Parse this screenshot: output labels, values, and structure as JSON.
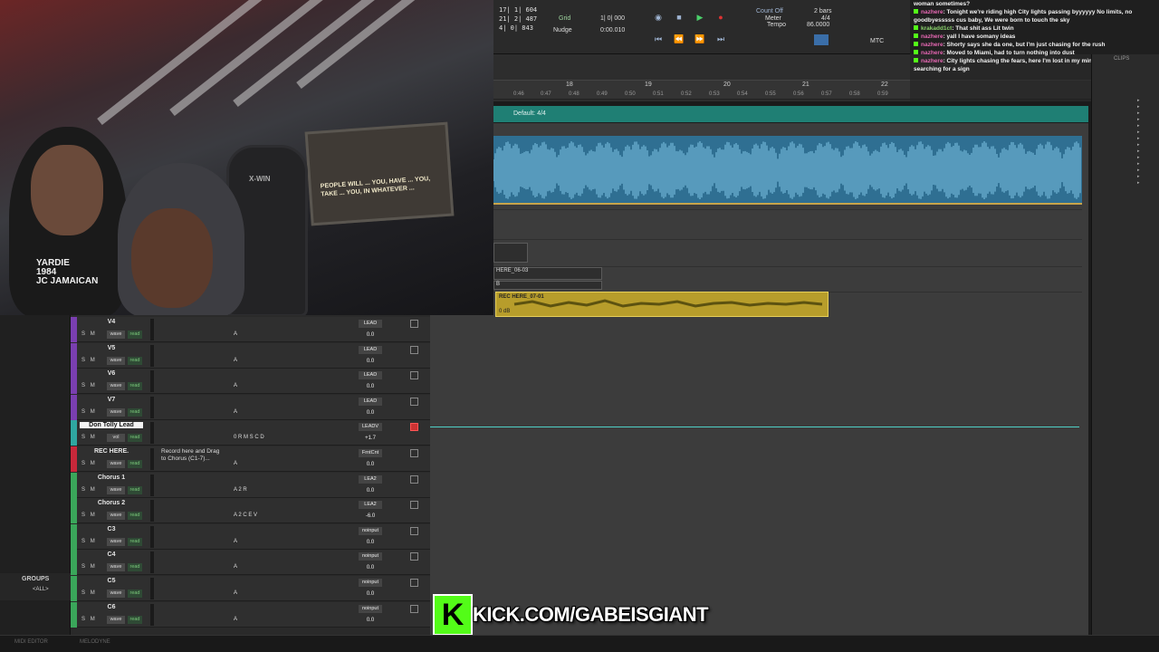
{
  "overlay": {
    "shirt_text_line1": "YARDIE",
    "shirt_text_line2": "1984",
    "shirt_text_line3": "JC JAMAICAN",
    "monitor_text": "PEOPLE WILL ... YOU, HAVE ... YOU, TAKE ... YOU, IN WHATEVER ...",
    "chair_brand": "X-WIN",
    "banner_url": "KICK.COM/GABEISGIANT",
    "banner_logo": "K",
    "banner_color": "#53fc18"
  },
  "transport": {
    "counter_main": "17| 1| 604",
    "counter_2": "21| 2| 487",
    "counter_3": "4| 0| 843",
    "grid_label": "Grid",
    "grid_value": "1| 0| 000",
    "nudge_label": "Nudge",
    "nudge_value": "0:00.010",
    "count_off": "Count Off",
    "meter_label": "Meter",
    "meter_value": "4/4",
    "tempo_label": "Tempo",
    "tempo_value": "86.0000",
    "bars_value": "2 bars",
    "mtc_label": "MTC"
  },
  "ruler": {
    "bars": [
      "18",
      "19",
      "20",
      "21",
      "22"
    ],
    "minutes": [
      "0:46",
      "0:47",
      "0:48",
      "0:49",
      "0:50",
      "0:51",
      "0:52",
      "0:53",
      "0:54",
      "0:55",
      "0:56",
      "0:57",
      "0:58",
      "0:59"
    ],
    "meter_lane_label": "Default: 4/4"
  },
  "clips": {
    "clip_a": "HERE_06-03",
    "clip_b": "B",
    "clip_yellow": "REC HERE_07-01",
    "clip_yellow_db": "0 dB",
    "clip_list_title": "CLIPS"
  },
  "chat": [
    {
      "user": "",
      "text": "woman sometimes?"
    },
    {
      "user": "nazhere",
      "text": ": Tonight we're riding high City lights passing byyyyyy No limits, no goodbyesssss cus baby, We were born to touch the sky"
    },
    {
      "user": "krakadd1ct",
      "text": ": That shit ass Lit twin"
    },
    {
      "user": "nazhere",
      "text": ": yall I have somany ideas"
    },
    {
      "user": "nazhere",
      "text": ": Shorty says she da one, but I'm just chasing for the rush"
    },
    {
      "user": "nazhere",
      "text": ": Moved to Miami, had to turn nothing into dust"
    },
    {
      "user": "nazhere",
      "text": ": City lights chasing the fears, here I'm lost in my mind Making a mil, still searching for a sign"
    }
  ],
  "tracks": [
    {
      "name": "V4",
      "color": "#7a3fb0",
      "comments": "",
      "io": "LEAD",
      "vol": "0.0",
      "ins": "A",
      "selected": false,
      "red": false
    },
    {
      "name": "V5",
      "color": "#7a3fb0",
      "comments": "",
      "io": "LEAD",
      "vol": "0.0",
      "ins": "A",
      "selected": false,
      "red": false
    },
    {
      "name": "V6",
      "color": "#7a3fb0",
      "comments": "",
      "io": "LEAD",
      "vol": "0.0",
      "ins": "A",
      "selected": false,
      "red": false
    },
    {
      "name": "V7",
      "color": "#7a3fb0",
      "comments": "",
      "io": "LEAD",
      "vol": "0.0",
      "ins": "A",
      "selected": false,
      "red": false
    },
    {
      "name": "Don Tolly Lead",
      "color": "#2fa6a0",
      "comments": "",
      "io": "LEADV",
      "vol": "+1.7",
      "ins": "0 R M S C D",
      "selected": true,
      "red": true
    },
    {
      "name": "REC HERE.",
      "color": "#c8283a",
      "comments": "Record here and Drag to Chorus (C1-7)...",
      "io": "FrntCnt",
      "vol": "0.0",
      "ins": "A",
      "selected": false,
      "red": false
    },
    {
      "name": "Chorus 1",
      "color": "#3aa65a",
      "comments": "",
      "io": "LEA2",
      "vol": "0.0",
      "ins": "A 2 R",
      "selected": false,
      "red": false
    },
    {
      "name": "Chorus 2",
      "color": "#3aa65a",
      "comments": "",
      "io": "LEA2",
      "vol": "-6.0",
      "ins": "A 2 C E V",
      "selected": false,
      "red": false
    },
    {
      "name": "C3",
      "color": "#3aa65a",
      "comments": "",
      "io": "noinput",
      "vol": "0.0",
      "ins": "A",
      "selected": false,
      "red": false
    },
    {
      "name": "C4",
      "color": "#3aa65a",
      "comments": "",
      "io": "noinput",
      "vol": "0.0",
      "ins": "A",
      "selected": false,
      "red": false
    },
    {
      "name": "C5",
      "color": "#3aa65a",
      "comments": "",
      "io": "noinput",
      "vol": "0.0",
      "ins": "A",
      "selected": false,
      "red": false
    },
    {
      "name": "C6",
      "color": "#3aa65a",
      "comments": "",
      "io": "noinput",
      "vol": "0.0",
      "ins": "A",
      "selected": false,
      "red": false
    }
  ],
  "track_buttons": {
    "mute": "M",
    "solo": "S",
    "wave": "wave",
    "read": "read",
    "vol": "vol"
  },
  "groups": {
    "title": "GROUPS",
    "all": "<ALL>"
  },
  "bottom_tabs": {
    "midi_editor": "MIDI EDITOR",
    "melodyne": "MELODYNE"
  }
}
